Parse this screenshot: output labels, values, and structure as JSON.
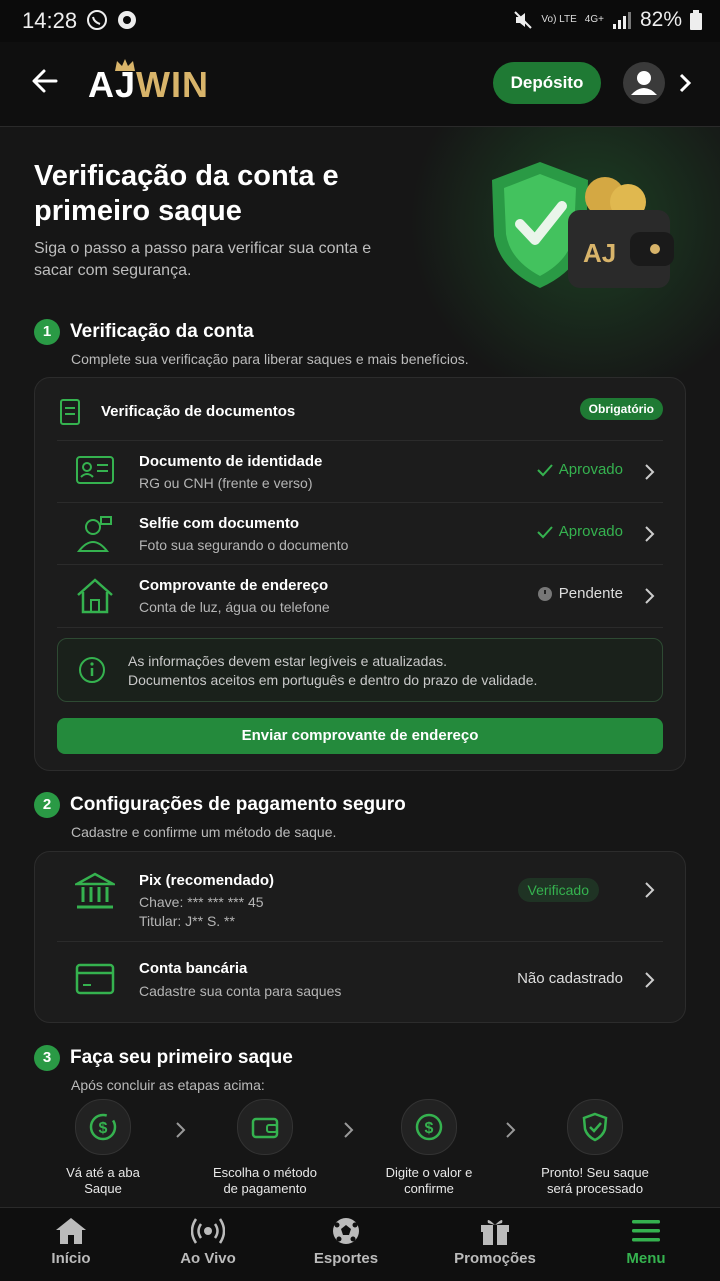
{
  "status_bar": {
    "time": "14:28",
    "network": "4G+",
    "volte": "Vo) LTE",
    "battery": "82%"
  },
  "header": {
    "logo_part1": "AJ",
    "logo_part2": "WIN",
    "deposit_label": "Depósito"
  },
  "hero": {
    "title": "Verificação da conta e primeiro saque",
    "subtitle": "Siga o passo a passo para verificar sua conta e sacar com segurança.",
    "wallet_logo": "AJ"
  },
  "step1": {
    "number": "1",
    "title": "Verificação da conta",
    "subtitle": "Complete sua verificação para liberar saques e mais benefícios.",
    "card_title": "Verificação de documentos",
    "badge": "Obrigatório",
    "items": [
      {
        "title": "Documento de identidade",
        "subtitle": "RG ou CNH (frente e verso)",
        "status": "Aprovado",
        "icon": "id-card-icon"
      },
      {
        "title": "Selfie com documento",
        "subtitle": "Foto sua segurando o documento",
        "status": "Aprovado",
        "icon": "selfie-icon"
      },
      {
        "title": "Comprovante de endereço",
        "subtitle": "Conta de luz, água ou telefone",
        "status": "Pendente",
        "icon": "home-icon"
      }
    ],
    "info_line1": "As informações devem estar legíveis e atualizadas.",
    "info_line2": "Documentos aceitos em português e dentro do prazo de validade.",
    "cta": "Enviar comprovante de endereço"
  },
  "step2": {
    "number": "2",
    "title": "Configurações de pagamento seguro",
    "subtitle": "Cadastre e confirme um método de saque.",
    "pix": {
      "title": "Pix (recomendado)",
      "key": "Chave: *** *** *** 45",
      "holder": "Titular: J** S. **",
      "status": "Verificado"
    },
    "bank": {
      "title": "Conta bancária",
      "subtitle": "Cadastre sua conta para saques",
      "status": "Não cadastrado"
    }
  },
  "step3": {
    "number": "3",
    "title": "Faça seu primeiro saque",
    "subtitle": "Após concluir as etapas acima:",
    "flow": [
      {
        "line1": "Vá até a aba",
        "line2": "Saque"
      },
      {
        "line1": "Escolha o método",
        "line2": "de pagamento"
      },
      {
        "line1": "Digite o valor e",
        "line2": "confirme"
      },
      {
        "line1": "Pronto! Seu saque",
        "line2": "será processado"
      }
    ]
  },
  "bottom_nav": [
    {
      "label": "Início",
      "icon": "home-icon"
    },
    {
      "label": "Ao Vivo",
      "icon": "live-icon"
    },
    {
      "label": "Esportes",
      "icon": "soccer-ball-icon"
    },
    {
      "label": "Promoções",
      "icon": "gift-icon"
    },
    {
      "label": "Menu",
      "icon": "menu-icon",
      "active": true
    }
  ],
  "colors": {
    "accent": "#35b24f",
    "button": "#248a3c",
    "gold": "#d8b46a",
    "background": "#161616"
  }
}
